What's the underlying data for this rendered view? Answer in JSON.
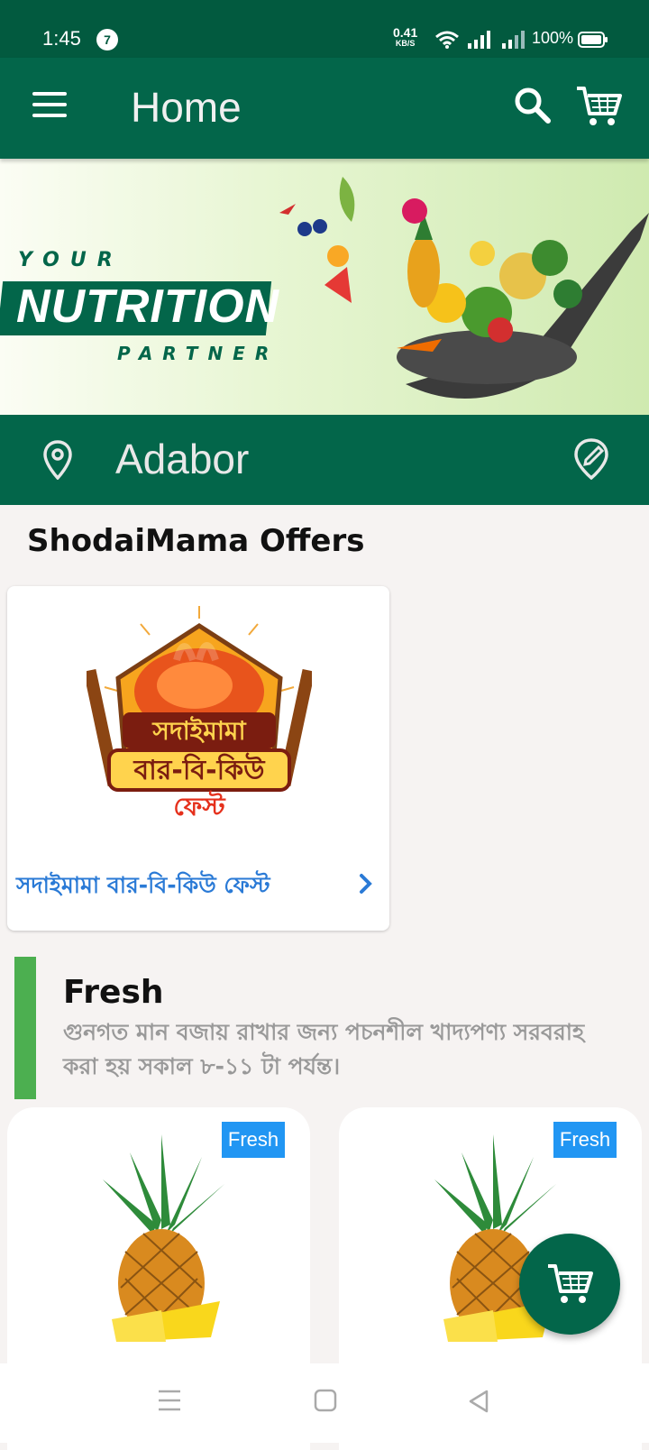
{
  "status_bar": {
    "time": "1:45",
    "notification_count": "7",
    "net_speed_value": "0.41",
    "net_speed_unit": "KB/S",
    "battery_percent": "100%"
  },
  "app_bar": {
    "title": "Home",
    "icons": [
      "menu-icon",
      "search-icon",
      "cart-icon"
    ]
  },
  "banner": {
    "line1": "YOUR",
    "line2": "NUTRITION",
    "line3": "PARTNER"
  },
  "location": {
    "name": "Adabor",
    "icons": [
      "location-pin-icon",
      "edit-location-icon"
    ]
  },
  "offers": {
    "section_title": "ShodaiMama Offers",
    "items": [
      {
        "name": "সদাইমামা বার-বি-কিউ ফেস্ট",
        "logo_text_line1": "সদাইমামা",
        "logo_text_line2": "বার-বি-কিউ",
        "logo_text_line3": "ফেস্ট"
      }
    ]
  },
  "fresh_section": {
    "title": "Fresh",
    "description": "গুনগত মান বজায় রাখার জন্য পচনশীল খাদ্যপণ্য সরবরাহ করা হয় সকাল ৮-১১ টা পর্যন্ত।",
    "products": [
      {
        "badge": "Fresh",
        "image": "pineapple"
      },
      {
        "badge": "Fresh",
        "image": "pineapple"
      }
    ]
  },
  "colors": {
    "primary": "#03664a",
    "status_bar": "#025a3f",
    "accent_green": "#4caf50",
    "badge_blue": "#2196f3",
    "link_blue": "#2a7ad6"
  }
}
